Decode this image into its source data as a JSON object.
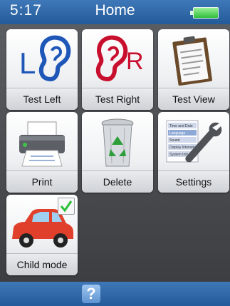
{
  "status": {
    "time": "5:17",
    "title": "Home",
    "battery_icon": "battery-full-icon"
  },
  "tiles": [
    {
      "label": "Test Left",
      "icon": "left-ear-icon"
    },
    {
      "label": "Test Right",
      "icon": "right-ear-icon"
    },
    {
      "label": "Test View",
      "icon": "clipboard-icon"
    },
    {
      "label": "Print",
      "icon": "printer-icon"
    },
    {
      "label": "Delete",
      "icon": "recycle-bin-icon"
    },
    {
      "label": "Settings",
      "icon": "wrench-icon"
    },
    {
      "label": "Child mode",
      "icon": "car-icon",
      "checked": true
    }
  ],
  "footer": {
    "help_label": "?"
  },
  "colors": {
    "accent_blue": "#2a64a8",
    "left_ear": "#1f57b8",
    "right_ear": "#c8102e",
    "check_green": "#2bbf3a",
    "car_red": "#e0402b"
  },
  "settings_menu_preview": [
    "Time and Date",
    "Language",
    "Sound",
    "Display Intensity",
    "System Info"
  ]
}
